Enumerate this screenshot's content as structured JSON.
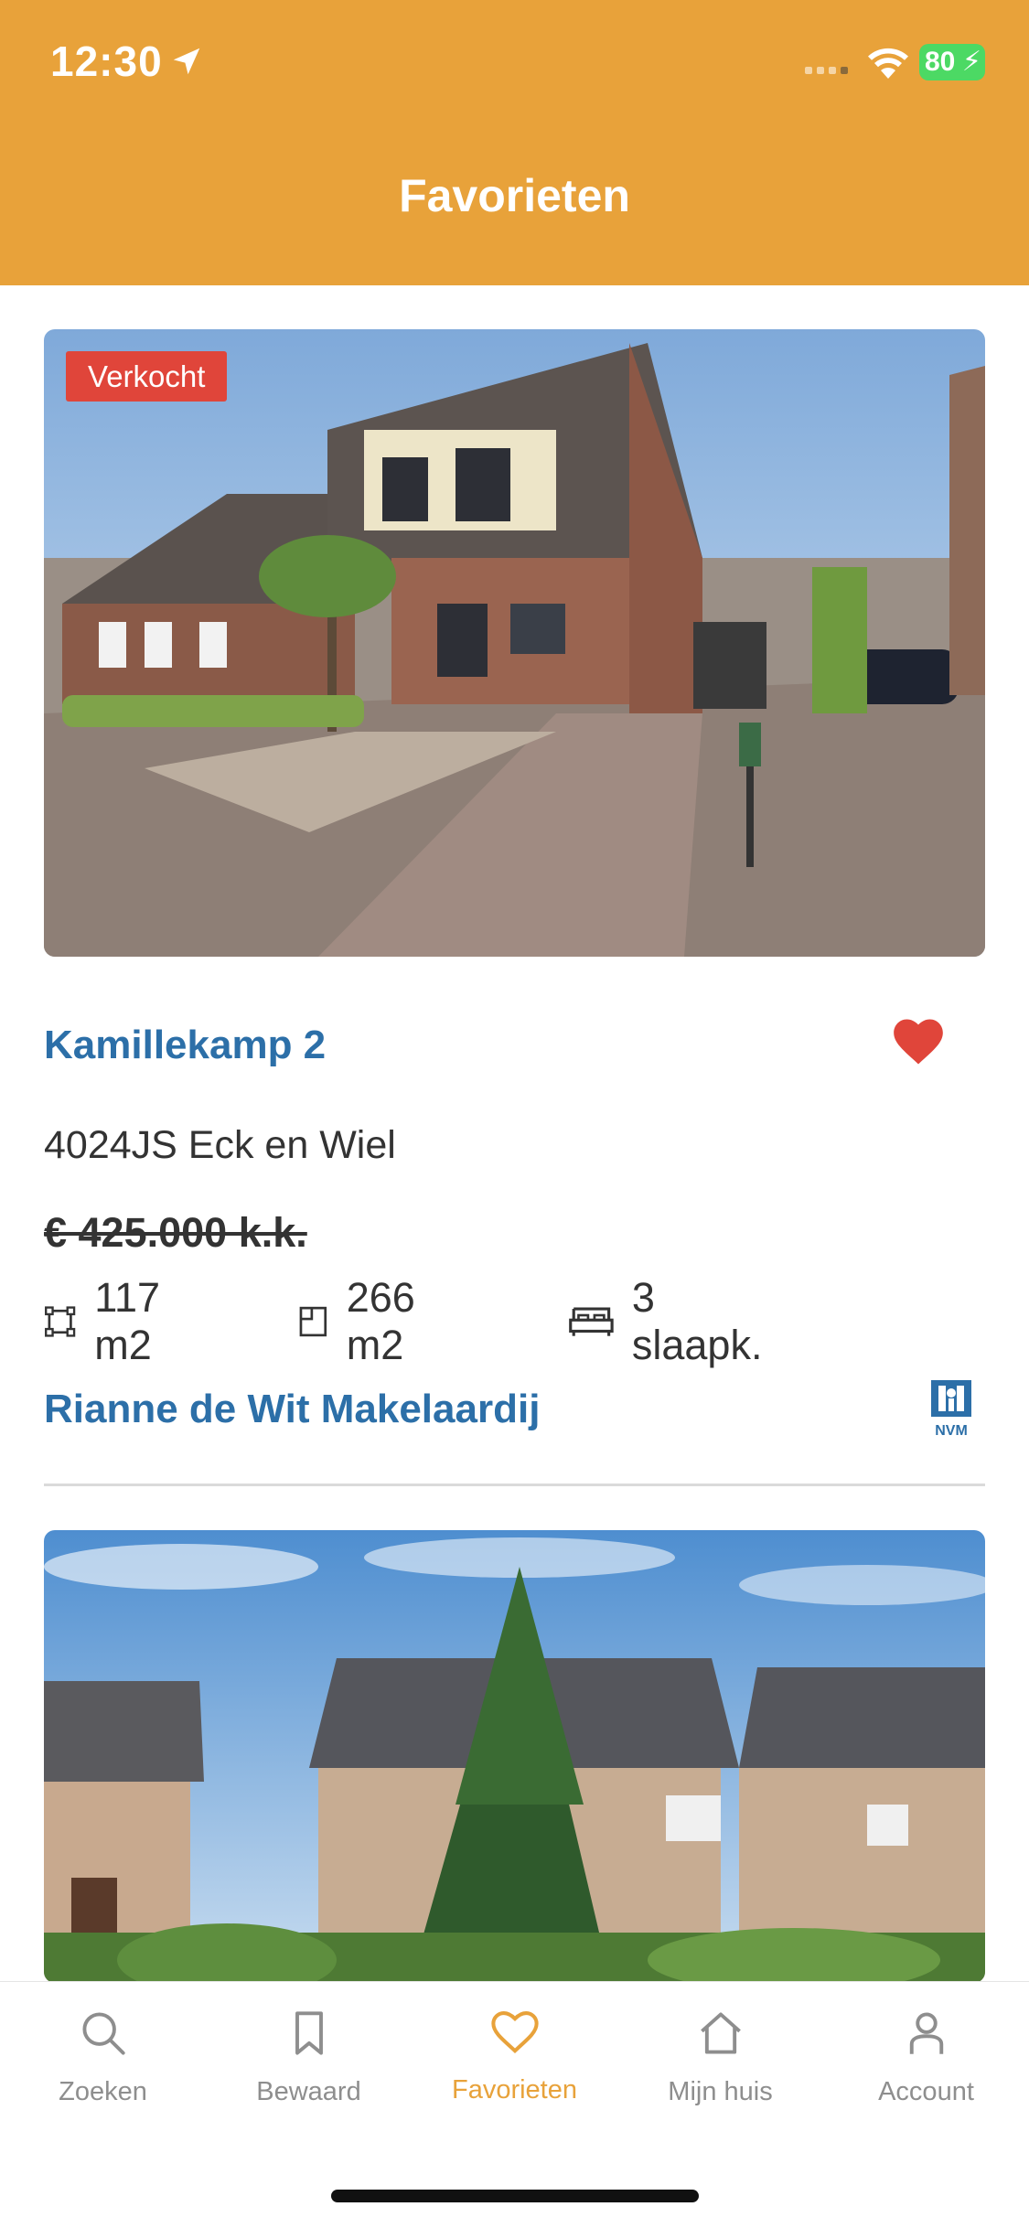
{
  "status_bar": {
    "time": "12:30",
    "battery": "80"
  },
  "header": {
    "title": "Favorieten"
  },
  "listings": [
    {
      "badge": "Verkocht",
      "street": "Kamillekamp 2",
      "postal_city": "4024JS Eck en Wiel",
      "price": "€ 425.000 k.k.",
      "living_area": "117 m2",
      "plot_area": "266 m2",
      "bedrooms": "3 slaapk.",
      "agent": "Rianne de Wit Makelaardij",
      "agent_logo_text": "NVM",
      "favorited": true
    }
  ],
  "tabbar": {
    "tabs": [
      {
        "label": "Zoeken",
        "icon": "search-icon"
      },
      {
        "label": "Bewaard",
        "icon": "bookmark-icon"
      },
      {
        "label": "Favorieten",
        "icon": "heart-icon",
        "active": true
      },
      {
        "label": "Mijn huis",
        "icon": "house-icon"
      },
      {
        "label": "Account",
        "icon": "person-icon"
      }
    ]
  },
  "colors": {
    "brand": "#E8A23A",
    "link": "#2C6FA8",
    "sold_badge": "#E0453A",
    "heart": "#E0453A"
  }
}
